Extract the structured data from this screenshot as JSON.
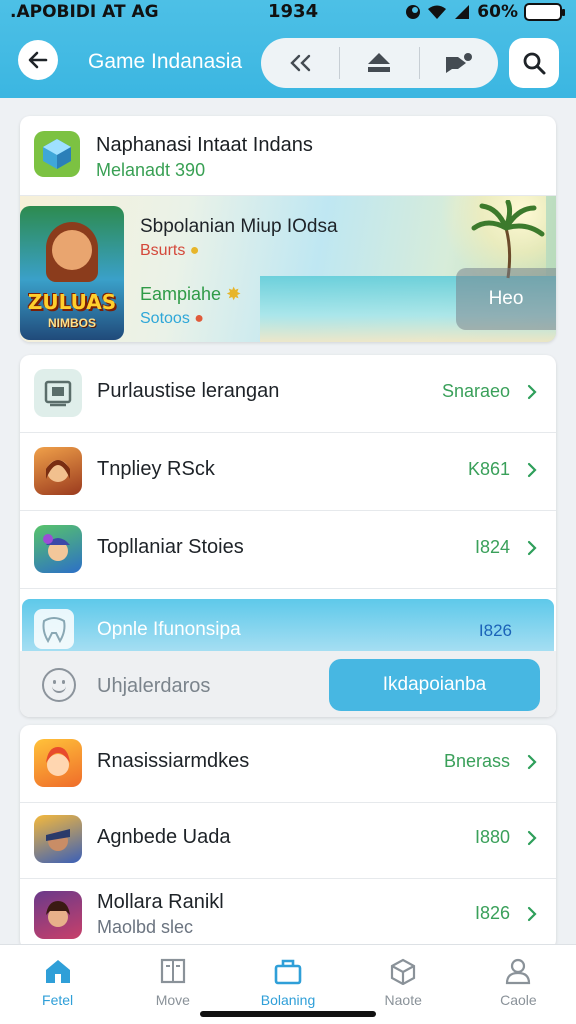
{
  "status_bar": {
    "left": ".APOBIDI AT AG",
    "time": "1934",
    "battery": "60%"
  },
  "header": {
    "title": "Game Indanasia",
    "back_icon": "arrow-left-icon",
    "actions": [
      "rewind-icon",
      "eject-icon",
      "pin-tag-icon"
    ],
    "search_icon": "search-icon"
  },
  "featured": {
    "title": "Naphanasi Intaat Indans",
    "subtitle": "Melanadt 390",
    "banner": {
      "game_logo": "ZULUAS",
      "game_logo_sub": "NIMBOS",
      "title": "Sbpolanian Miup IOdsa",
      "line1": "Bsurts",
      "line2": "Eampiahe",
      "line3": "Sotoos",
      "button": "Heo"
    }
  },
  "list1": {
    "rows": [
      {
        "label": "Purlaustise lerangan",
        "value": "Snaraeo"
      },
      {
        "label": "Tnpliey RSck",
        "value": "K861"
      },
      {
        "label": "Topllaniar Stoies",
        "value": "I824"
      }
    ],
    "selected": {
      "label": "Opnle Ifunonsipa",
      "value": "I826"
    },
    "action": {
      "label": "Uhjalerdaros",
      "button": "Ikdapoianba"
    }
  },
  "list2": {
    "rows": [
      {
        "label": "Rnasissiarmdkes",
        "value": "Bnerass"
      },
      {
        "label": "Agnbede Uada",
        "value": "I880"
      },
      {
        "label": "Mollara Ranikl",
        "sublabel": "Maolbd slec",
        "value": "I826"
      }
    ]
  },
  "bottom_nav": [
    {
      "label": "Fetel",
      "icon": "home-icon",
      "active": true
    },
    {
      "label": "Move",
      "icon": "book-icon",
      "active": false
    },
    {
      "label": "Bolaning",
      "icon": "bag-icon",
      "active": true
    },
    {
      "label": "Naote",
      "icon": "box-icon",
      "active": false
    },
    {
      "label": "Caole",
      "icon": "user-icon",
      "active": false
    }
  ],
  "colors": {
    "header": "#3bb6e1",
    "accent_green": "#3aa05a",
    "accent_blue": "#2f9fd8",
    "button_blue": "#47b7e2"
  }
}
